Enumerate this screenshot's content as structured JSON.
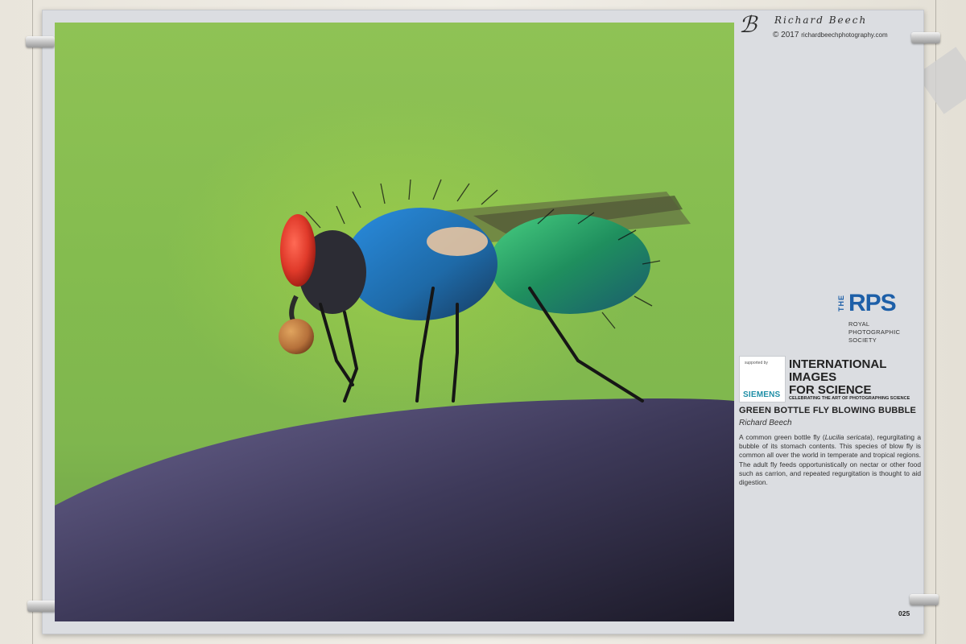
{
  "photographer_signature": {
    "mark": "ℬ",
    "name": "Richard Beech",
    "copyright": "© 2017",
    "website": "richardbeechphotography.com"
  },
  "organization": {
    "name_prefix": "THE",
    "name": "RPS",
    "full_name_lines": [
      "ROYAL",
      "PHOTOGRAPHIC",
      "SOCIETY"
    ]
  },
  "exhibition": {
    "supported_by_label": "supported by",
    "sponsor": "SIEMENS",
    "title_lines": [
      "INTERNATIONAL",
      "IMAGES",
      "FOR SCIENCE"
    ],
    "tagline": "CELEBRATING THE ART OF PHOTOGRAPHING SCIENCE"
  },
  "artwork": {
    "title": "GREEN BOTTLE FLY BLOWING BUBBLE",
    "author": "Richard Beech",
    "description_before": "A common green bottle fly (",
    "species": "Lucilia sericata",
    "description_after": "), regurgitating a bubble of its stomach contents. This species of blow fly is common all over the world in temperate and tropical regions. The adult fly feeds opportunistically on nectar or other food such as carrion, and repeated regurgitation is thought to aid digestion.",
    "number": "025"
  },
  "colors": {
    "rps_blue": "#1d5fa8",
    "siemens_teal": "#1e8ea6",
    "background_green": "#84bc4f",
    "fly_eye_red": "#e03a2a",
    "fly_body_green": "#2ea36a"
  }
}
